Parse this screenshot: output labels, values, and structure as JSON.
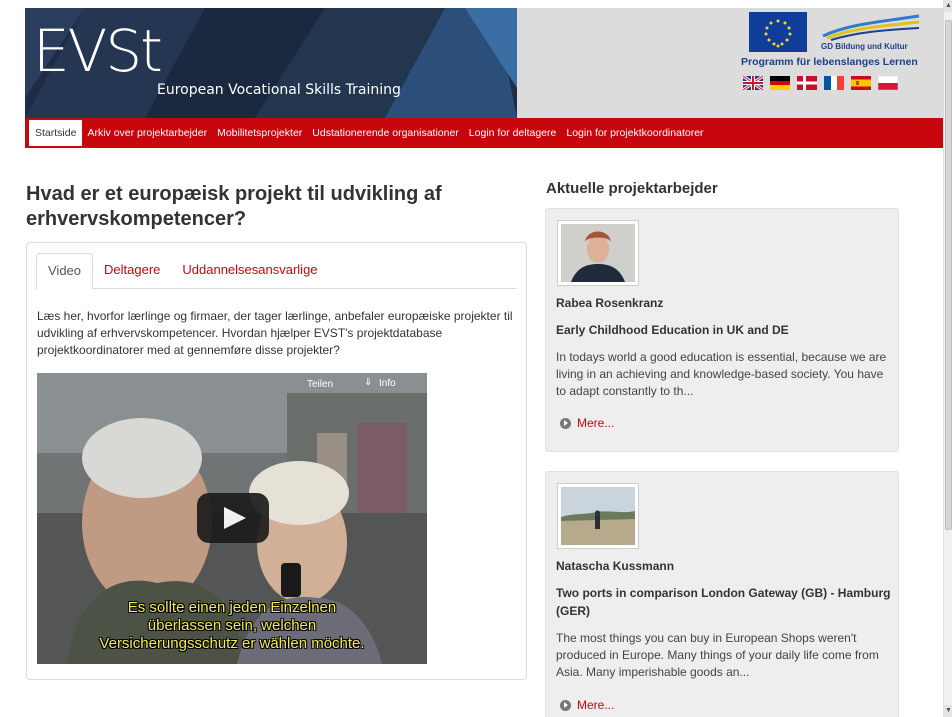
{
  "header": {
    "logo": "EVSt",
    "logo_subtitle": "European Vocational Skills Training",
    "gd_text": "GD Bildung und Kultur",
    "program_text": "Programm für lebenslanges Lernen",
    "flags": [
      "uk-flag-icon",
      "germany-flag-icon",
      "denmark-flag-icon",
      "france-flag-icon",
      "spain-flag-icon",
      "poland-flag-icon"
    ]
  },
  "nav": {
    "items": [
      "Startside",
      "Arkiv over projektarbejder",
      "Mobilitetsprojekter",
      "Udstationerende organisationer",
      "Login for deltagere",
      "Login for projektkoordinatorer"
    ]
  },
  "main": {
    "title": "Hvad er et europæisk projekt til udvikling af erhvervskompetencer?",
    "tabs": [
      "Video",
      "Deltagere",
      "Uddannelsesansvarlige"
    ],
    "intro": "Læs her, hvorfor lærlinge og firmaer, der tager lærlinge, anbefaler europæiske projekter til udvikling af erhvervskompetencer. Hvordan hjælper EVST's projektdatabase projektkoordinatorer med at gennemføre disse projekter?",
    "video": {
      "share_label": "Teilen",
      "info_label": "Info",
      "subtitle_lines": [
        "Es sollte einen jeden Einzelnen",
        "überlassen sein, welchen",
        "Versicherungsschutz er wählen möchte."
      ]
    }
  },
  "sidebar": {
    "title": "Aktuelle projektarbejder",
    "more_label": "Mere...",
    "cards": [
      {
        "name": "Rabea Rosenkranz",
        "subject": "Early Childhood Education in UK and DE",
        "text": "In todays world a good education is essential, because we are living in an achieving and knowledge-based society. You have to adapt constantly to th..."
      },
      {
        "name": "Natascha Kussmann",
        "subject": "Two ports in comparison London Gateway (GB) - Hamburg (GER)",
        "text": "The most things you can buy in European Shops weren't produced in Europe. Many things of your daily life come from Asia. Many imperishable goods an..."
      }
    ]
  },
  "colors": {
    "accent": "#c8060e",
    "banner": "#1e2d45",
    "eu_blue": "#103d99"
  }
}
